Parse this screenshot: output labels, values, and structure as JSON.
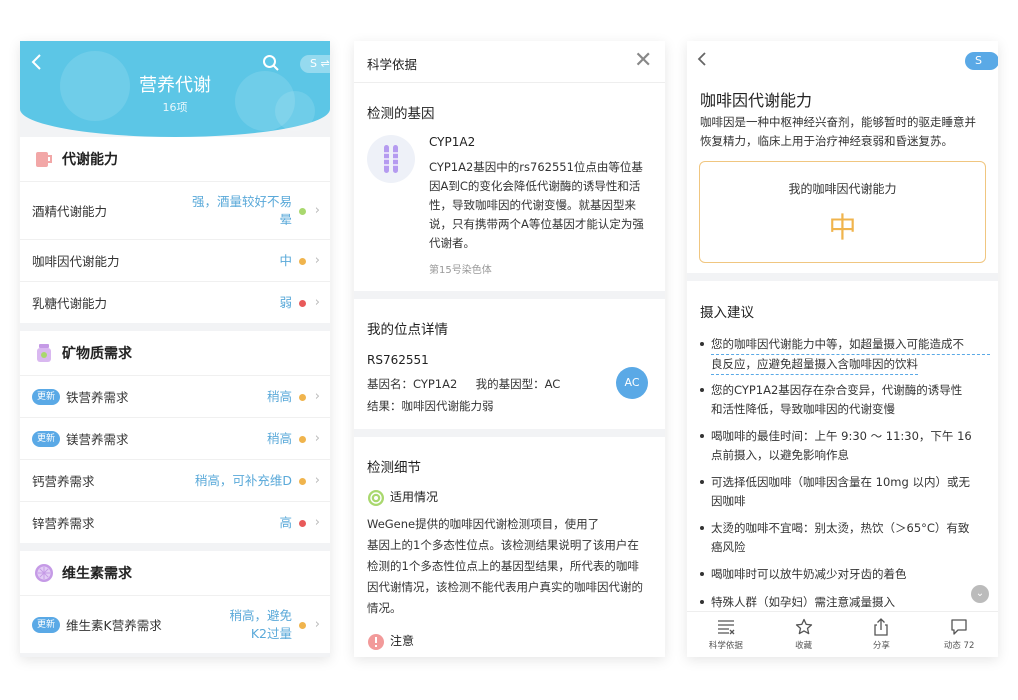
{
  "panel1": {
    "title": "营养代谢",
    "count": "16项",
    "toggle": "S ⇌",
    "sections": [
      {
        "title": "代谢能力",
        "rows": [
          {
            "name": "酒精代谢能力",
            "value_line1": "强，酒量较好不易",
            "value_line2": "晕",
            "dot_color": "#a9d86e"
          },
          {
            "name": "咖啡因代谢能力",
            "value_line1": "中",
            "dot_color": "#f0b44d"
          },
          {
            "name": "乳糖代谢能力",
            "value_line1": "弱",
            "dot_color": "#e85a5a"
          }
        ]
      },
      {
        "title": "矿物质需求",
        "rows": [
          {
            "badge": "更新",
            "name": "铁营养需求",
            "value_line1": "稍高",
            "dot_color": "#f0b44d"
          },
          {
            "badge": "更新",
            "name": "镁营养需求",
            "value_line1": "稍高",
            "dot_color": "#f0b44d"
          },
          {
            "name": "钙营养需求",
            "value_line1": "稍高，可补充维D",
            "dot_color": "#f0b44d"
          },
          {
            "name": "锌营养需求",
            "value_line1": "高",
            "dot_color": "#e85a5a"
          }
        ]
      },
      {
        "title": "维生素需求",
        "rows": [
          {
            "badge": "更新",
            "name": "维生素K营养需求",
            "value_line1": "稍高，避免",
            "value_line2": "K2过量",
            "dot_color": "#f0b44d"
          }
        ]
      }
    ]
  },
  "panel2": {
    "title": "科学依据",
    "gene_section": "检测的基因",
    "gene_name": "CYP1A2",
    "gene_desc_lines": [
      "CYP1A2基因中的rs762551位点由等位基",
      "因A到C的变化会降低代谢酶的诱导性和活",
      "性，导致咖啡因的代谢变慢。就基因型来",
      "说，只有携带两个A等位基因才能认定为强",
      "代谢者。"
    ],
    "gene_italic": "CYP1A2",
    "chromosome": "第15号染色体",
    "site_section": "我的位点详情",
    "site_id": "RS762551",
    "site_gene": "基因名：CYP1A2     我的基因型：AC",
    "site_result": "结果：咖啡因代谢能力弱",
    "genotype": "AC",
    "detail_section": "检测细节",
    "applicable": "适用情况",
    "applicable_lines": [
      "WeGene提供的咖啡因代谢检测项目，使用了",
      "基因上的1个多态性位点。该检测结果说明了该用户在",
      "检测的1个多态性位点上的基因型结果，所代表的咖啡",
      "因代谢情况，该检测不能代表用户真实的咖啡因代谢的",
      "情况。"
    ],
    "note": "注意"
  },
  "panel3": {
    "toggle": "S ⇌",
    "title": "咖啡因代谢能力",
    "desc_lines": [
      "咖啡因是一种中枢神经兴奋剂，能够暂时的驱走睡意并",
      "恢复精力，临床上用于治疗神经衰弱和昏迷复苏。"
    ],
    "my_capacity_label": "我的咖啡因代谢能力",
    "my_capacity_value": "中",
    "suggestion_title": "摄入建议",
    "bullets": [
      [
        "您的咖啡因代谢能力中等，如超量摄入可能造成不",
        "良反应，应避免超量摄入含咖啡因的饮料"
      ],
      [
        "您的CYP1A2基因存在杂合变异，代谢酶的诱导性",
        "和活性降低，导致咖啡因的代谢变慢"
      ],
      [
        "喝咖啡的最佳时间：上午 9:30 ～ 11:30，下午 16",
        "点前摄入，以避免影响作息"
      ],
      [
        "可选择低因咖啡（咖啡因含量在 10mg 以内）或无",
        "因咖啡"
      ],
      [
        "太烫的咖啡不宜喝：别太烫，热饮（＞65°C）有致",
        "癌风险"
      ],
      [
        "喝咖啡时可以放牛奶减少对牙齿的着色"
      ],
      [
        "特殊人群（如孕妇）需注意减量摄入"
      ]
    ],
    "tabs": [
      {
        "label": "科学依据",
        "icon": "list-icon"
      },
      {
        "label": "收藏",
        "icon": "star-icon"
      },
      {
        "label": "分享",
        "icon": "share-icon"
      },
      {
        "label": "动态 72",
        "icon": "comment-icon"
      }
    ]
  }
}
